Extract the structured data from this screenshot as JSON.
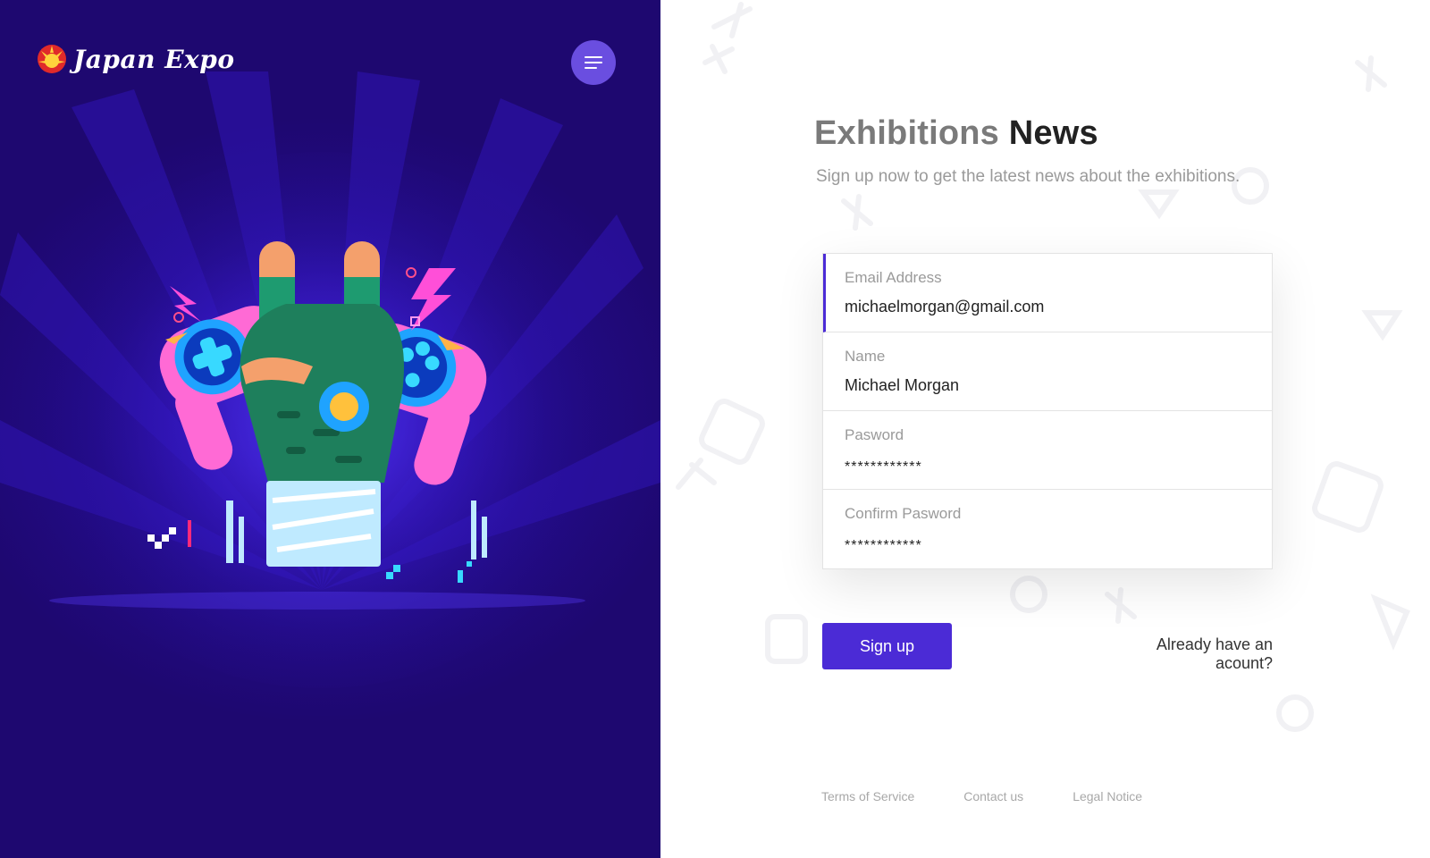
{
  "brand": {
    "name": "Japan Expo",
    "logo_icon": "sun-emblem-icon"
  },
  "nav": {
    "menu_icon": "hamburger-menu-icon"
  },
  "hero": {
    "illustration": "gamer-hand-with-controllers-illustration"
  },
  "heading": {
    "light": "Exhibitions",
    "bold": "News"
  },
  "subtitle": "Sign up now to get the latest news about the exhibitions.",
  "form": {
    "fields": [
      {
        "label": "Email Address",
        "value": "michaelmorgan@gmail.com"
      },
      {
        "label": "Name",
        "value": "Michael Morgan"
      },
      {
        "label": "Pasword",
        "value": "************"
      },
      {
        "label": "Confirm Pasword",
        "value": "************"
      }
    ],
    "submit_label": "Sign up",
    "login_link": "Already have an acount?"
  },
  "footer": {
    "links": [
      "Terms of Service",
      "Contact us",
      "Legal Notice"
    ]
  },
  "colors": {
    "accent": "#4b2bd6",
    "hero_bg": "#220b86",
    "menu_button": "#6a4ee0"
  }
}
